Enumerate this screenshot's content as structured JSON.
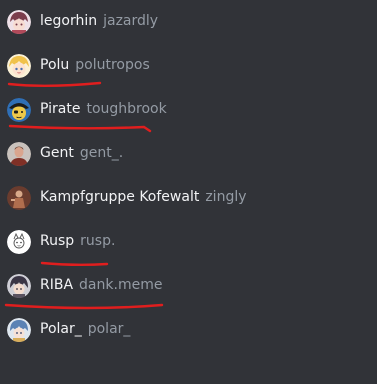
{
  "members": [
    {
      "display_name": "legorhin",
      "username": "jazardly",
      "avatar_icon": "anime-avatar-icon",
      "avatar_colors": [
        "#efe1e8",
        "#7b3d4c"
      ]
    },
    {
      "display_name": "Polu",
      "username": "polutropos",
      "avatar_icon": "anime-avatar-icon",
      "avatar_colors": [
        "#fbf1d6",
        "#f0c24c"
      ]
    },
    {
      "display_name": "Pirate",
      "username": "toughbrook",
      "avatar_icon": "pirate-avatar-icon",
      "avatar_colors": [
        "#2f6fb6",
        "#efc94a"
      ]
    },
    {
      "display_name": "Gent",
      "username": "gent_.",
      "avatar_icon": "person-avatar-icon",
      "avatar_colors": [
        "#c9c2bd",
        "#6d4a3c"
      ]
    },
    {
      "display_name": "Kampfgruppe Kofewalt",
      "username": "zingly",
      "avatar_icon": "figure-avatar-icon",
      "avatar_colors": [
        "#6a3c2e",
        "#b06e4e"
      ]
    },
    {
      "display_name": "Rusp",
      "username": "rusp.",
      "avatar_icon": "sketch-avatar-icon",
      "avatar_colors": [
        "#ffffff",
        "#777777"
      ]
    },
    {
      "display_name": "RIBA",
      "username": "dank.meme",
      "avatar_icon": "anime-avatar-icon",
      "avatar_colors": [
        "#cfcfd6",
        "#3a3545"
      ]
    },
    {
      "display_name": "Polar_",
      "username": "polar_",
      "avatar_icon": "anime-avatar-icon",
      "avatar_colors": [
        "#dfe7ef",
        "#5b82b4"
      ]
    }
  ],
  "colors": {
    "background": "#313338",
    "display_name": "#f2f3f5",
    "username": "#949ba4",
    "annotation_underline": "#e01e1e"
  }
}
